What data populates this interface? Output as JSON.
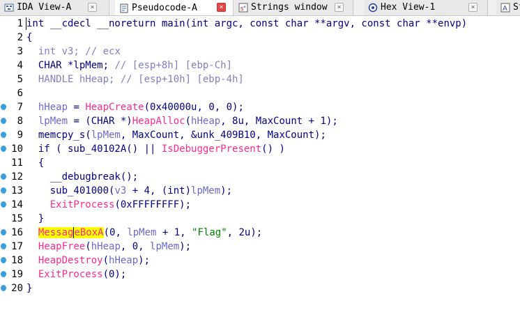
{
  "tabs": [
    {
      "label": "IDA View-A",
      "icon": "ida-view-icon",
      "active": false
    },
    {
      "label": "Pseudocode-A",
      "icon": "pseudocode-icon",
      "active": true
    },
    {
      "label": "Strings window",
      "icon": "strings-icon",
      "active": false
    },
    {
      "label": "Hex View-1",
      "icon": "hex-view-icon",
      "active": false
    },
    {
      "label": "Str",
      "icon": "structures-icon",
      "active": false
    }
  ],
  "close_glyph": "×",
  "colors": {
    "keyword": "#000080",
    "variable": "#6a6ac8",
    "function": "#ff2c8c",
    "string": "#008000",
    "comment": "#8080c0",
    "highlight": "#ffff00",
    "breakpoint_dot": "#3a9ee0"
  },
  "code_lines": [
    {
      "num": "1",
      "dot": false,
      "tokens": [
        [
          "kw",
          "int __cdecl __noreturn main(int argc, const char **argv, const char **envp)"
        ]
      ]
    },
    {
      "num": "2",
      "dot": false,
      "tokens": [
        [
          "kw",
          "{"
        ]
      ]
    },
    {
      "num": "3",
      "dot": false,
      "tokens": [
        [
          "cmt",
          "  int v3; "
        ],
        [
          "cmt",
          "// ecx"
        ]
      ]
    },
    {
      "num": "4",
      "dot": false,
      "tokens": [
        [
          "kw",
          "  CHAR *lpMem; "
        ],
        [
          "cmt",
          "// [esp+8h] [ebp-Ch]"
        ]
      ]
    },
    {
      "num": "5",
      "dot": false,
      "tokens": [
        [
          "cmt",
          "  HANDLE hHeap; "
        ],
        [
          "cmt",
          "// [esp+10h] [ebp-4h]"
        ]
      ]
    },
    {
      "num": "6",
      "dot": false,
      "tokens": []
    },
    {
      "num": "7",
      "dot": true,
      "tokens": [
        [
          "kw",
          "  "
        ],
        [
          "var",
          "hHeap"
        ],
        [
          "kw",
          " = "
        ],
        [
          "func",
          "HeapCreate"
        ],
        [
          "kw",
          "(0x40000u, 0, 0);"
        ]
      ]
    },
    {
      "num": "8",
      "dot": true,
      "tokens": [
        [
          "kw",
          "  "
        ],
        [
          "var",
          "lpMem"
        ],
        [
          "kw",
          " = (CHAR *)"
        ],
        [
          "func",
          "HeapAlloc"
        ],
        [
          "kw",
          "("
        ],
        [
          "var",
          "hHeap"
        ],
        [
          "kw",
          ", 8u, MaxCount + 1);"
        ]
      ]
    },
    {
      "num": "9",
      "dot": true,
      "tokens": [
        [
          "kw",
          "  memcpy_s("
        ],
        [
          "var",
          "lpMem"
        ],
        [
          "kw",
          ", MaxCount, &unk_409B10, MaxCount);"
        ]
      ]
    },
    {
      "num": "10",
      "dot": true,
      "tokens": [
        [
          "kw",
          "  if ( sub_40102A() || "
        ],
        [
          "func",
          "IsDebuggerPresent"
        ],
        [
          "kw",
          "() )"
        ]
      ]
    },
    {
      "num": "11",
      "dot": false,
      "tokens": [
        [
          "kw",
          "  {"
        ]
      ]
    },
    {
      "num": "12",
      "dot": true,
      "tokens": [
        [
          "kw",
          "    __debugbreak();"
        ]
      ]
    },
    {
      "num": "13",
      "dot": true,
      "tokens": [
        [
          "kw",
          "    sub_401000("
        ],
        [
          "var",
          "v3"
        ],
        [
          "kw",
          " + 4, (int)"
        ],
        [
          "var",
          "lpMem"
        ],
        [
          "kw",
          ");"
        ]
      ]
    },
    {
      "num": "14",
      "dot": true,
      "tokens": [
        [
          "kw",
          "    "
        ],
        [
          "func",
          "ExitProcess"
        ],
        [
          "kw",
          "(0xFFFFFFFF);"
        ]
      ]
    },
    {
      "num": "15",
      "dot": false,
      "tokens": [
        [
          "kw",
          "  }"
        ]
      ]
    },
    {
      "num": "16",
      "dot": true,
      "tokens": [
        [
          "kw",
          "  "
        ],
        [
          "funchl",
          "MessageBoxA"
        ],
        [
          "kw",
          "(0, "
        ],
        [
          "var",
          "lpMem"
        ],
        [
          "kw",
          " + 1, "
        ],
        [
          "str",
          "\"Flag\""
        ],
        [
          "kw",
          ", 2u);"
        ]
      ]
    },
    {
      "num": "17",
      "dot": true,
      "tokens": [
        [
          "kw",
          "  "
        ],
        [
          "func",
          "HeapFree"
        ],
        [
          "kw",
          "("
        ],
        [
          "var",
          "hHeap"
        ],
        [
          "kw",
          ", 0, "
        ],
        [
          "var",
          "lpMem"
        ],
        [
          "kw",
          ");"
        ]
      ]
    },
    {
      "num": "18",
      "dot": true,
      "tokens": [
        [
          "kw",
          "  "
        ],
        [
          "func",
          "HeapDestroy"
        ],
        [
          "kw",
          "("
        ],
        [
          "var",
          "hHeap"
        ],
        [
          "kw",
          ");"
        ]
      ]
    },
    {
      "num": "19",
      "dot": true,
      "tokens": [
        [
          "kw",
          "  "
        ],
        [
          "func",
          "ExitProcess"
        ],
        [
          "kw",
          "(0);"
        ]
      ]
    },
    {
      "num": "20",
      "dot": true,
      "tokens": [
        [
          "kw",
          "}"
        ]
      ]
    }
  ]
}
